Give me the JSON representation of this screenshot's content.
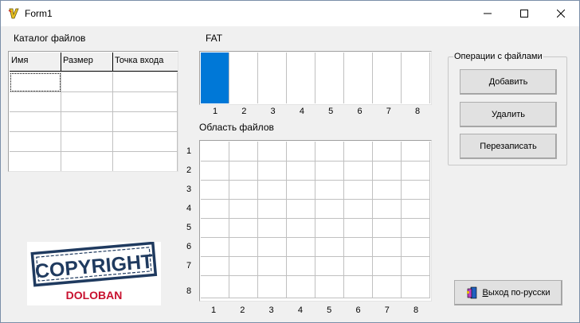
{
  "window": {
    "title": "Form1"
  },
  "catalog": {
    "title": "Каталог файлов",
    "columns": [
      "Имя",
      "Размер",
      "Точка входа"
    ],
    "rows": 5
  },
  "fat": {
    "title": "FAT",
    "cells": [
      1,
      0,
      0,
      0,
      0,
      0,
      0,
      0
    ],
    "col_numbers": [
      "1",
      "2",
      "3",
      "4",
      "5",
      "6",
      "7",
      "8"
    ],
    "used_color": "#0078d7"
  },
  "files_area": {
    "title": "Область файлов",
    "col_numbers": [
      "1",
      "2",
      "3",
      "4",
      "5",
      "6",
      "7",
      "8"
    ],
    "row_numbers": [
      "1",
      "2",
      "3",
      "4",
      "5",
      "6",
      "7",
      "8"
    ]
  },
  "operations": {
    "title": "Операции с файлами",
    "add_label": "Добавить",
    "delete_label": "Удалить",
    "rewrite_label": "Перезаписать"
  },
  "logo": {
    "line1": "COPYRIGHT",
    "line2": "DOLOBAN"
  },
  "exit_button": {
    "label": "Выход по-русски"
  }
}
